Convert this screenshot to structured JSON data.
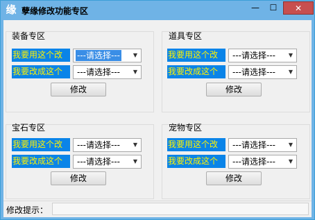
{
  "window": {
    "title": "孽缘修改功能专区",
    "app_icon_glyph": "缘",
    "minimize_glyph": "—",
    "maximize_glyph": "☐",
    "close_glyph": "✕"
  },
  "colors": {
    "titlebar": "#6fb3e6",
    "label_bg": "#0a84e8",
    "label_text": "#fff200",
    "close_bg": "#c74f4f"
  },
  "sections": [
    {
      "title": "装备专区",
      "rows": [
        {
          "label": "我要用这个改",
          "select_value": "---请选择---"
        },
        {
          "label": "我要改成这个",
          "select_value": "---请选择---"
        }
      ],
      "button": "修改"
    },
    {
      "title": "道具专区",
      "rows": [
        {
          "label": "我要用这个改",
          "select_value": "---请选择---"
        },
        {
          "label": "我要改成这个",
          "select_value": "---请选择---"
        }
      ],
      "button": "修改"
    },
    {
      "title": "宝石专区",
      "rows": [
        {
          "label": "我要用这个改",
          "select_value": "---请选择---"
        },
        {
          "label": "我要改成这个",
          "select_value": "---请选择---"
        }
      ],
      "button": "修改"
    },
    {
      "title": "宠物专区",
      "rows": [
        {
          "label": "我要用这个改",
          "select_value": "---请选择---"
        },
        {
          "label": "我要改成这个",
          "select_value": "---请选择---"
        }
      ],
      "button": "修改"
    }
  ],
  "status": {
    "label": "修改提示：",
    "value": ""
  }
}
